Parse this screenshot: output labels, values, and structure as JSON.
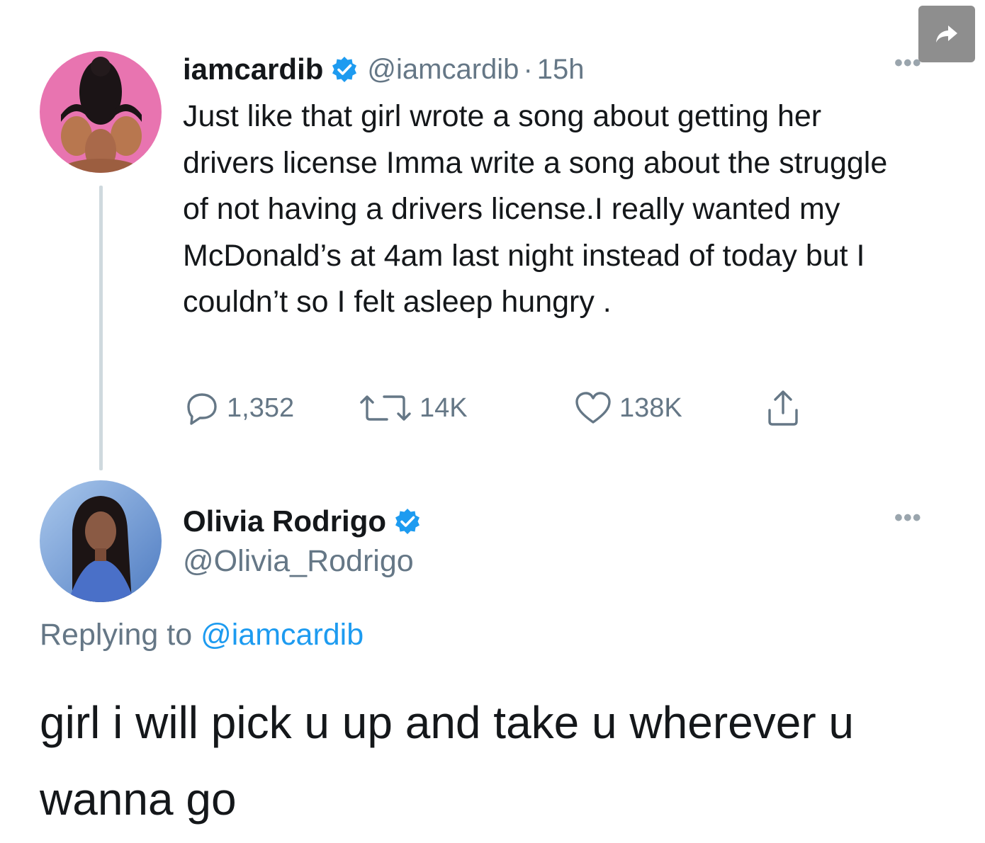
{
  "share_button": {
    "icon": "forward-arrow-icon"
  },
  "tweet1": {
    "display_name": "iamcardib",
    "verified": true,
    "handle": "@iamcardib",
    "separator": "·",
    "time": "15h",
    "more_icon": "more-dots-icon",
    "more_label": "•••",
    "text": "Just like that girl wrote a song about getting her drivers license Imma write a song about the struggle of not having a drivers license.I really wanted my McDonald’s at 4am last night instead of today but I couldn’t so I felt asleep hungry .",
    "replies": "1,352",
    "retweets": "14K",
    "likes": "138K"
  },
  "tweet2": {
    "display_name": "Olivia Rodrigo",
    "verified": true,
    "handle": "@Olivia_Rodrigo",
    "more_label": "•••",
    "replying_prefix": "Replying to",
    "replying_to": "@iamcardib",
    "text": "girl i will pick u up and take u wherever u wanna go"
  },
  "colors": {
    "verified_blue": "#1d9bf0",
    "muted_text": "#657786",
    "link_blue": "#1d9bf0",
    "avatar1_bg": "#e874b0",
    "avatar2_bg": "#7fa6d8"
  }
}
